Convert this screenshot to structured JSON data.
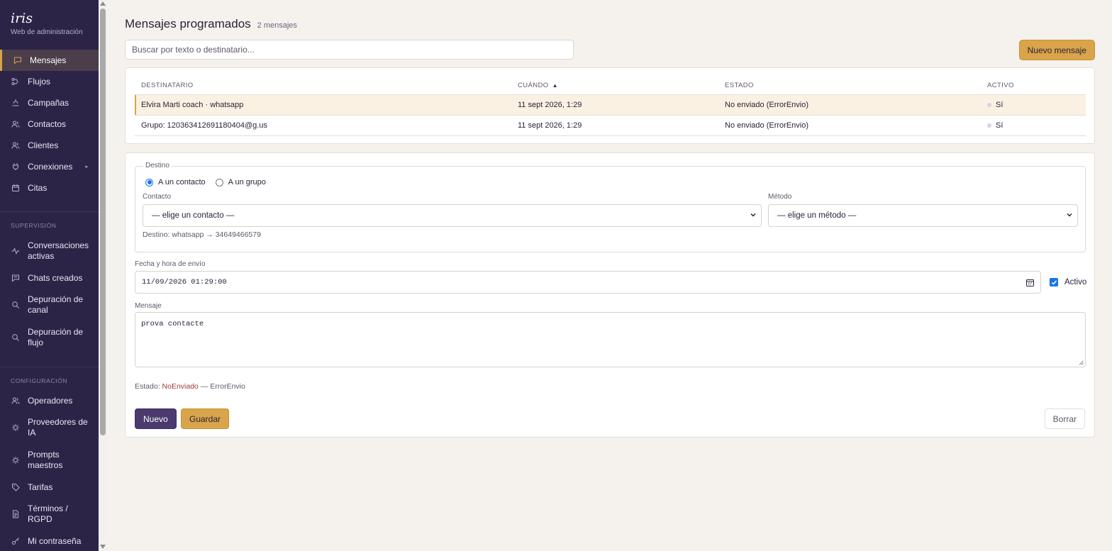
{
  "brand": {
    "logo": "iris",
    "subtitle": "Web de administración"
  },
  "sidebar": {
    "main_items": [
      {
        "label": "Mensajes",
        "icon": "message-icon",
        "active": true
      },
      {
        "label": "Flujos",
        "icon": "flow-icon"
      },
      {
        "label": "Campañas",
        "icon": "campaign-icon"
      },
      {
        "label": "Contactos",
        "icon": "contacts-icon"
      },
      {
        "label": "Clientes",
        "icon": "clients-icon"
      },
      {
        "label": "Conexiones",
        "icon": "plug-icon",
        "has_submenu": true
      },
      {
        "label": "Citas",
        "icon": "calendar-icon"
      }
    ],
    "supervision_title": "SUPERVISIÓN",
    "supervision_items": [
      {
        "label": "Conversaciones activas",
        "icon": "activity-icon"
      },
      {
        "label": "Chats creados",
        "icon": "chat-icon"
      },
      {
        "label": "Depuración de canal",
        "icon": "search-icon"
      },
      {
        "label": "Depuración de flujo",
        "icon": "search-icon"
      }
    ],
    "config_title": "CONFIGURACIÓN",
    "config_items": [
      {
        "label": "Operadores",
        "icon": "users-icon"
      },
      {
        "label": "Proveedores de IA",
        "icon": "chip-icon"
      },
      {
        "label": "Prompts maestros",
        "icon": "chip-icon"
      },
      {
        "label": "Tarifas",
        "icon": "tag-icon"
      },
      {
        "label": "Términos / RGPD",
        "icon": "document-icon"
      },
      {
        "label": "Mi contraseña",
        "icon": "key-icon"
      }
    ]
  },
  "header": {
    "title": "Mensajes programados",
    "count": "2 mensajes"
  },
  "search": {
    "placeholder": "Buscar por texto o destinatario...",
    "value": ""
  },
  "toolbar": {
    "new_message_label": "Nuevo mensaje"
  },
  "table": {
    "columns": {
      "recipient": "DESTINATARIO",
      "when": "CUÁNDO",
      "status": "ESTADO",
      "active": "ACTIVO"
    },
    "sort_indicator": "▲",
    "rows": [
      {
        "recipient": "Elvira Marti coach · whatsapp",
        "when": "11 sept 2026, 1:29",
        "status": "No enviado (ErrorEnvio)",
        "active": "Sí",
        "selected": true
      },
      {
        "recipient": "Grupo: 120363412691180404@g.us",
        "when": "11 sept 2026, 1:29",
        "status": "No enviado (ErrorEnvio)",
        "active": "Sí",
        "selected": false
      }
    ]
  },
  "form": {
    "destino_legend": "Destino",
    "radio_contact": "A un contacto",
    "radio_group": "A un grupo",
    "radio_selected": "contact",
    "contact_label": "Contacto",
    "contact_value": "— elige un contacto —",
    "method_label": "Método",
    "method_value": "— elige un método —",
    "destino_info": "Destino: whatsapp → 34649466579",
    "datetime_label": "Fecha y hora de envío",
    "datetime_value": "11/09/2026 01:29:00",
    "active_label": "Activo",
    "active_checked": true,
    "message_label": "Mensaje",
    "message_value": "prova contacte",
    "estado_prefix": "Estado:",
    "estado_value": "NoEnviado",
    "estado_suffix": "— ErrorEnvio",
    "btn_new": "Nuevo",
    "btn_save": "Guardar",
    "btn_delete": "Borrar"
  },
  "colors": {
    "sidebar_bg": "#2c2447",
    "accent": "#d9a44a",
    "primary": "#4a3a6e",
    "error": "#a33a3a",
    "background": "#f5f2ee"
  }
}
